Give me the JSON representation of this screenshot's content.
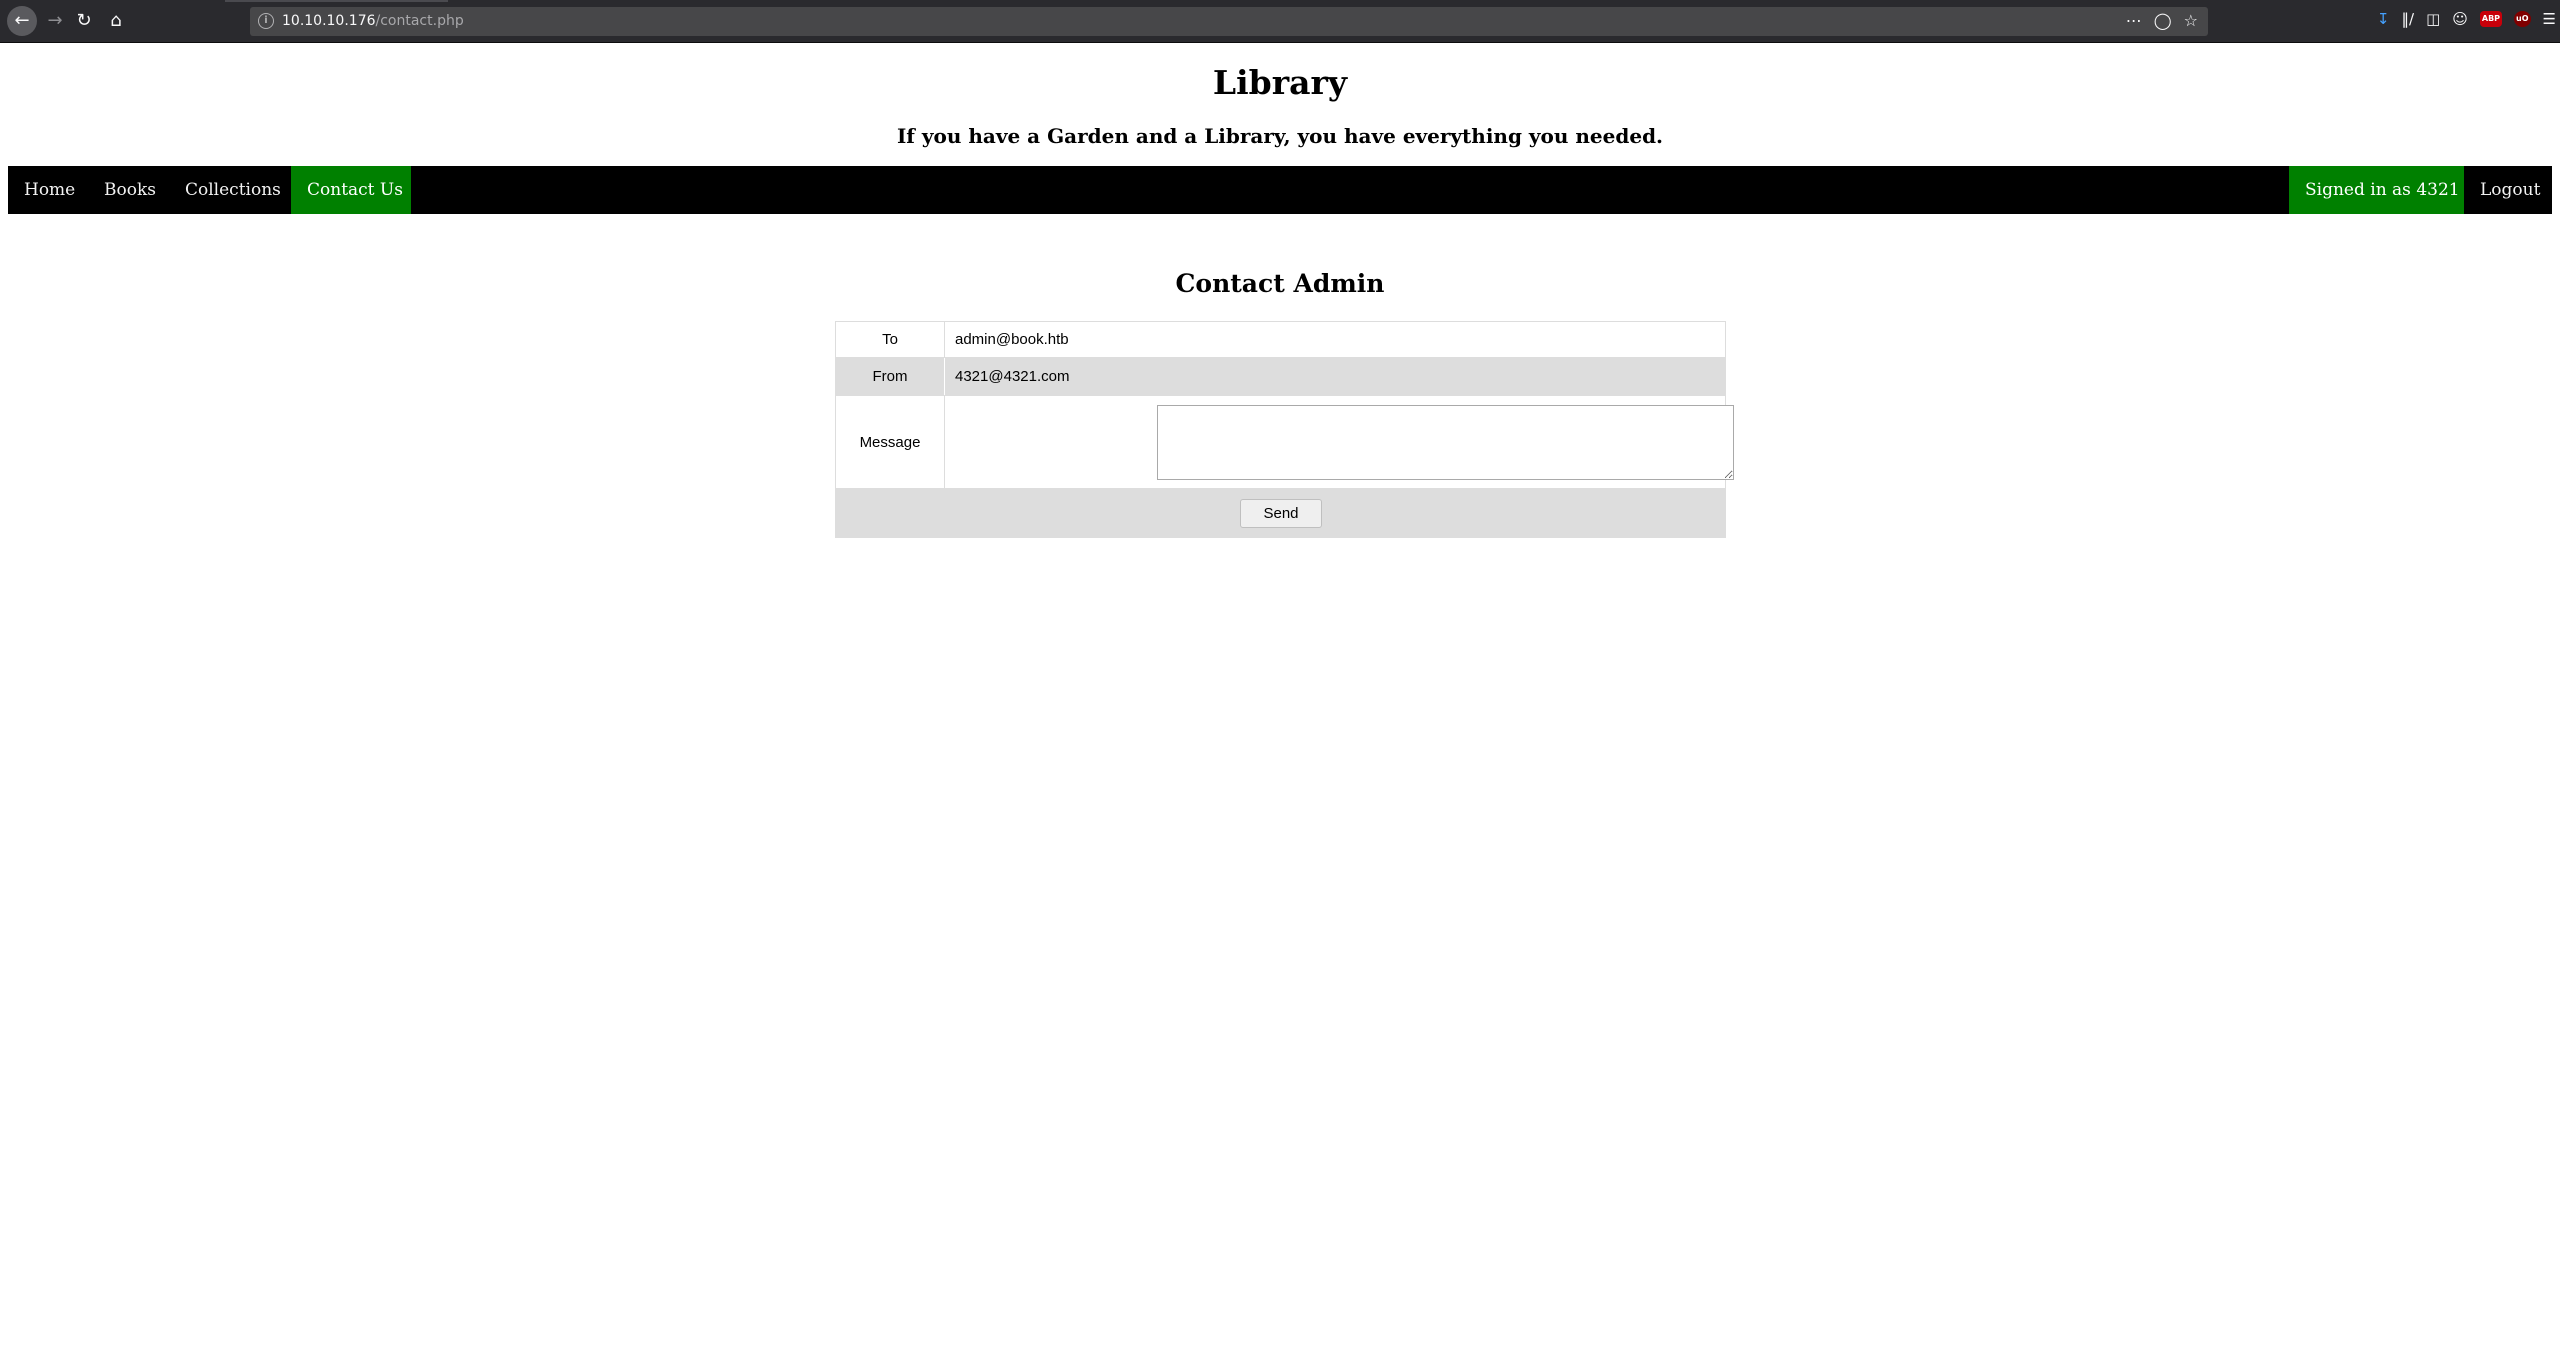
{
  "browser": {
    "url_host": "10.10.10.176",
    "url_path": "/contact.php",
    "nav_icons": [
      "back-arrow-icon",
      "forward-arrow-icon",
      "reload-icon",
      "home-icon"
    ],
    "url_icons": [
      "info-icon",
      "page-actions-icon",
      "pocket-icon",
      "bookmark-star-icon"
    ],
    "toolbar_icons": [
      "download-icon",
      "library-icon",
      "sidebar-icon",
      "account-icon",
      "adblock-icon",
      "ublock-icon",
      "menu-icon"
    ],
    "adblock_label": "ABP",
    "ublock_label": "uO"
  },
  "site": {
    "title": "Library",
    "tagline": "If you have a Garden and a Library, you have everything you needed."
  },
  "nav": {
    "home": "Home",
    "books": "Books",
    "collections": "Collections",
    "contact": "Contact Us",
    "signed_in": "Signed in as 4321",
    "logout": "Logout",
    "active_color": "#008000",
    "bar_color": "#000000"
  },
  "contact": {
    "heading": "Contact Admin",
    "to_label": "To",
    "to_value": "admin@book.htb",
    "from_label": "From",
    "from_value": "4321@4321.com",
    "message_label": "Message",
    "message_value": "",
    "send_label": "Send"
  }
}
